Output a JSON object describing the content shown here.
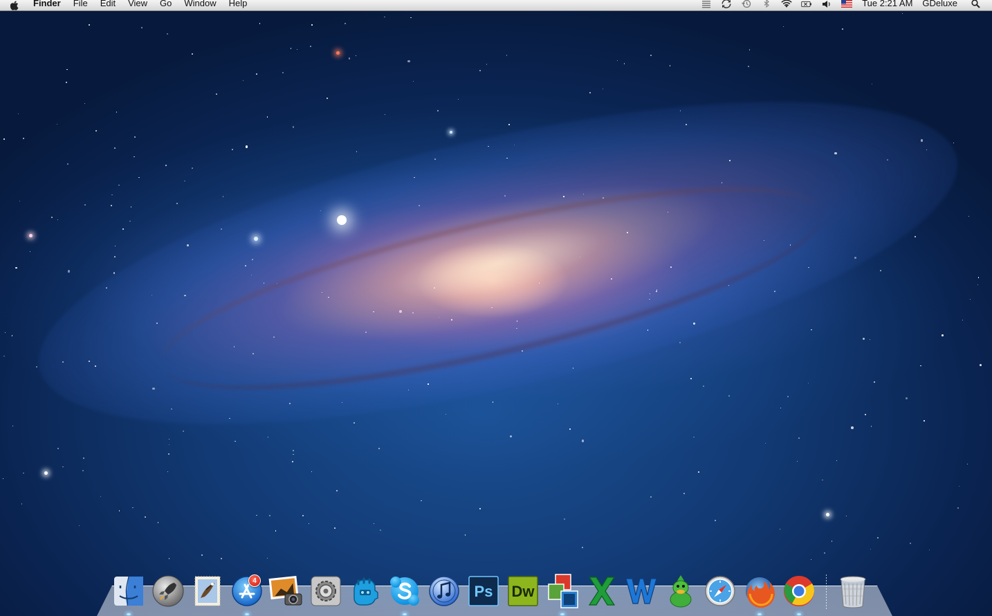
{
  "menubar": {
    "apple_icon": "apple-icon",
    "app_name": "Finder",
    "menus": [
      "File",
      "Edit",
      "View",
      "Go",
      "Window",
      "Help"
    ],
    "status_icons": [
      "menu-extras-icon",
      "sync-icon",
      "time-machine-icon",
      "bluetooth-icon",
      "wifi-icon",
      "battery-icon",
      "volume-icon",
      "us-flag-icon"
    ],
    "clock": "Tue 2:21 AM",
    "user": "GDeluxe",
    "spotlight_icon": "search-icon"
  },
  "dock": {
    "items": [
      {
        "name": "finder",
        "icon": "finder-icon"
      },
      {
        "name": "launchpad",
        "icon": "rocket-icon"
      },
      {
        "name": "mail",
        "icon": "mail-stamp-icon"
      },
      {
        "name": "app-store",
        "icon": "app-store-icon",
        "badge": "4"
      },
      {
        "name": "iphoto",
        "icon": "photo-camera-icon"
      },
      {
        "name": "system-preferences",
        "icon": "gear-icon"
      },
      {
        "name": "mpc-robot",
        "icon": "robot-icon"
      },
      {
        "name": "skype",
        "icon": "skype-icon"
      },
      {
        "name": "itunes",
        "icon": "music-note-icon"
      },
      {
        "name": "photoshop",
        "icon": "photoshop-icon",
        "label": "Ps"
      },
      {
        "name": "dreamweaver",
        "icon": "dreamweaver-icon",
        "label": "Dw"
      },
      {
        "name": "windows-app",
        "icon": "windows-stack-icon"
      },
      {
        "name": "excel",
        "icon": "excel-icon"
      },
      {
        "name": "word",
        "icon": "word-icon"
      },
      {
        "name": "adium",
        "icon": "duck-icon"
      },
      {
        "name": "safari",
        "icon": "compass-icon"
      },
      {
        "name": "firefox",
        "icon": "firefox-icon"
      },
      {
        "name": "chrome",
        "icon": "chrome-icon"
      }
    ],
    "trash": {
      "name": "trash",
      "icon": "trash-icon"
    },
    "colors": {
      "photoshop": "#0e2a4d",
      "photoshop_text": "#6fc8ff",
      "dreamweaver": "#8db61e",
      "dreamweaver_text": "#1a2a06",
      "excel": "#1f9d3a",
      "word": "#1e77d6",
      "badge": "#d0150a"
    }
  }
}
